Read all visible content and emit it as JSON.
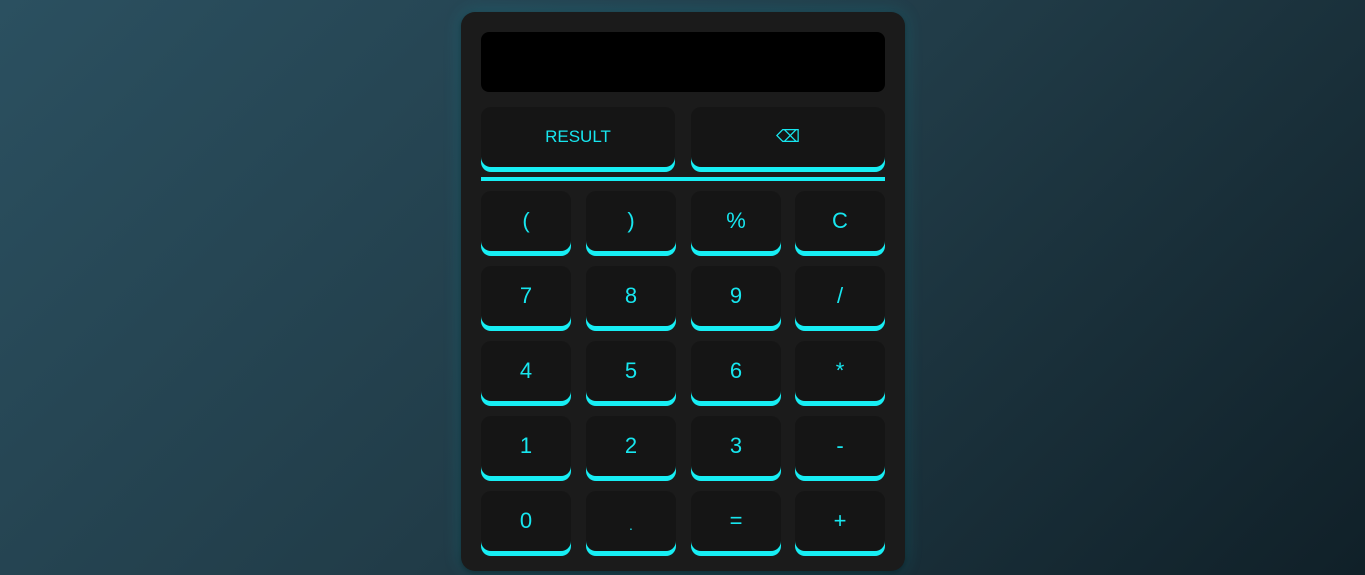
{
  "display": {
    "value": ""
  },
  "top_row": {
    "result_label": "RESULT",
    "backspace_glyph": "⌫"
  },
  "keys": {
    "row1": [
      "(",
      ")",
      "%",
      "C"
    ],
    "row2": [
      "7",
      "8",
      "9",
      "/"
    ],
    "row3": [
      "4",
      "5",
      "6",
      "*"
    ],
    "row4": [
      "1",
      "2",
      "3",
      "-"
    ],
    "row5": [
      "0",
      ".",
      "=",
      "+"
    ]
  },
  "colors": {
    "accent": "#17eef4",
    "key_bg": "#151515",
    "body_bg": "#1b1b1b",
    "display_bg": "#000000"
  }
}
